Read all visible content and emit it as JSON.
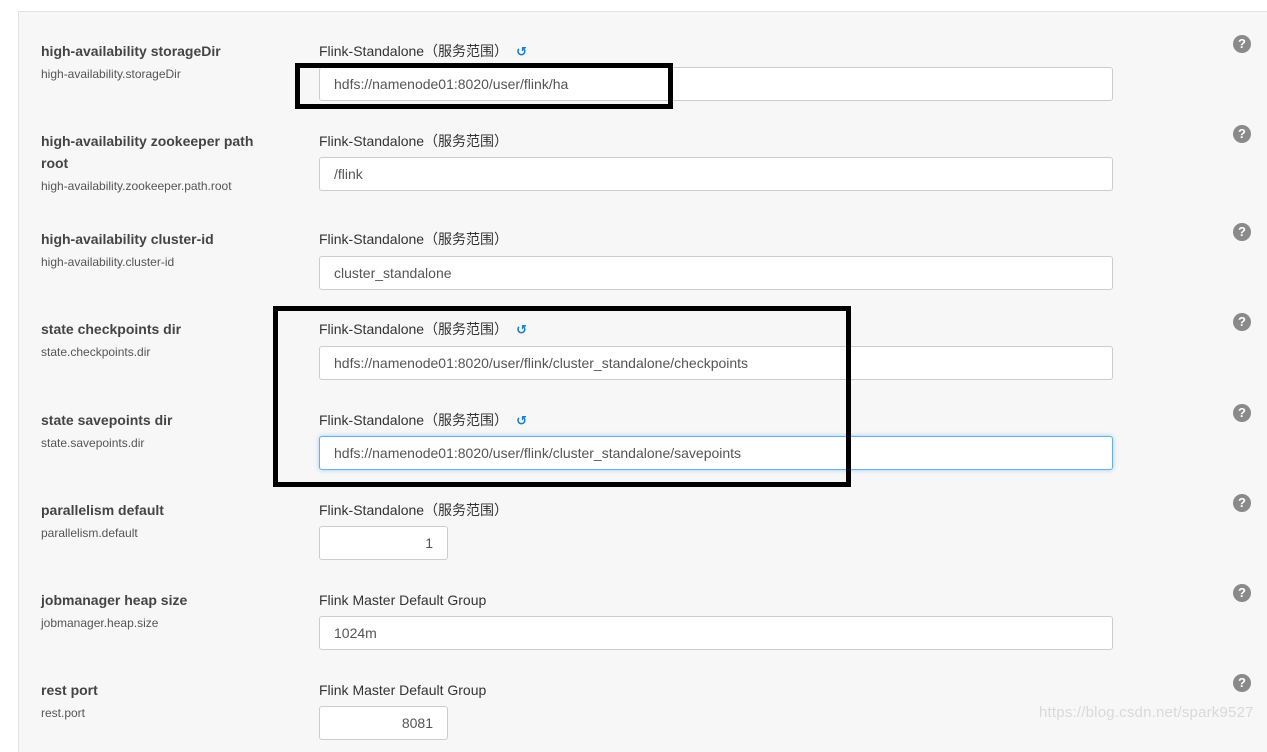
{
  "icons": {
    "undo": "undo-icon",
    "help": "question-circle-icon"
  },
  "colors": {
    "undo": "#1b7fc4",
    "focus": "#66afe9",
    "highlight_box": "#000000"
  },
  "rows": [
    {
      "name": "high-availability storageDir",
      "key": "high-availability.storageDir",
      "group": "Flink-Standalone（服务范围）",
      "modified": true,
      "value": "hdfs://namenode01:8020/user/flink/ha"
    },
    {
      "name": "high-availability zookeeper path root",
      "key": "high-availability.zookeeper.path.root",
      "group": "Flink-Standalone（服务范围）",
      "modified": false,
      "value": "/flink"
    },
    {
      "name": "high-availability cluster-id",
      "key": "high-availability.cluster-id",
      "group": "Flink-Standalone（服务范围）",
      "modified": false,
      "value": "cluster_standalone"
    },
    {
      "name": "state checkpoints dir",
      "key": "state.checkpoints.dir",
      "group": "Flink-Standalone（服务范围）",
      "modified": true,
      "value": "hdfs://namenode01:8020/user/flink/cluster_standalone/checkpoints"
    },
    {
      "name": "state savepoints dir",
      "key": "state.savepoints.dir",
      "group": "Flink-Standalone（服务范围）",
      "modified": true,
      "value": "hdfs://namenode01:8020/user/flink/cluster_standalone/savepoints"
    },
    {
      "name": "parallelism default",
      "key": "parallelism.default",
      "group": "Flink-Standalone（服务范围）",
      "modified": false,
      "value": "1"
    },
    {
      "name": "jobmanager heap size",
      "key": "jobmanager.heap.size",
      "group": "Flink Master Default Group",
      "modified": false,
      "value": "1024m"
    },
    {
      "name": "rest port",
      "key": "rest.port",
      "group": "Flink Master Default Group",
      "modified": false,
      "value": "8081"
    }
  ],
  "undo_glyph": "↺",
  "help_glyph": "?",
  "watermark": "https://blog.csdn.net/spark9527"
}
